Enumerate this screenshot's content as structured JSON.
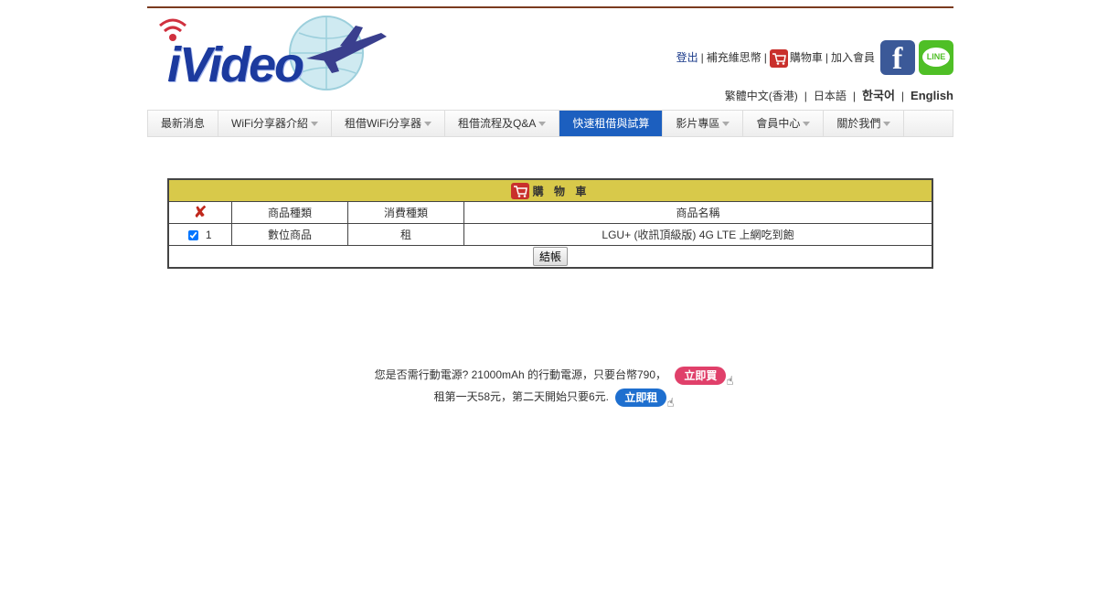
{
  "header": {
    "logo_text": "iVideo",
    "links": {
      "logout": "登出",
      "topup": "補充維思幣",
      "cart": "購物車",
      "join": "加入會員"
    },
    "social": {
      "facebook_label": "f",
      "line_label": "LINE"
    },
    "languages": [
      "繁體中文(香港)",
      "日本語",
      "한국어",
      "English"
    ]
  },
  "nav": {
    "items": [
      {
        "label": "最新消息",
        "has_caret": false
      },
      {
        "label": "WiFi分享器介紹",
        "has_caret": true
      },
      {
        "label": "租借WiFi分享器",
        "has_caret": true
      },
      {
        "label": "租借流程及Q&A",
        "has_caret": true
      },
      {
        "label": "快速租借與試算",
        "has_caret": false,
        "active": true
      },
      {
        "label": "影片專區",
        "has_caret": true
      },
      {
        "label": "會員中心",
        "has_caret": true
      },
      {
        "label": "關於我們",
        "has_caret": true
      }
    ]
  },
  "cart": {
    "title": "購 物 車",
    "columns": [
      "商品種類",
      "消費種類",
      "商品名稱"
    ],
    "rows": [
      {
        "index": "1",
        "checked": true,
        "category": "數位商品",
        "type": "租",
        "name": "LGU+ (收訊頂級版) 4G LTE 上網吃到飽"
      }
    ],
    "checkout_label": "結帳"
  },
  "promo": {
    "line1": "您是否需行動電源? 21000mAh 的行動電源，只要台幣790，",
    "buy_label": "立即買",
    "line2": "租第一天58元，第二天開始只要6元.",
    "rent_label": "立即租"
  },
  "colors": {
    "nav_active": "#1c5fbf",
    "cart_header": "#d8c94a",
    "buy_button": "#e0406a",
    "rent_button": "#1e6fcf"
  }
}
